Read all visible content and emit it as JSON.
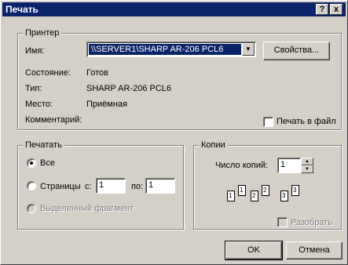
{
  "dialog": {
    "title": "Печать",
    "help_label": "?",
    "close_label": "x"
  },
  "printer": {
    "group_title": "Принтер",
    "name_label": "Имя:",
    "name_value": "\\\\SERVER1\\SHARP AR-206 PCL6",
    "properties_button": "Свойства...",
    "status_label": "Состояние:",
    "status_value": "Готов",
    "type_label": "Тип:",
    "type_value": "SHARP AR-206 PCL6",
    "location_label": "Место:",
    "location_value": "Приёмная",
    "comment_label": "Комментарий:",
    "print_to_file_label": "Печать в файл"
  },
  "print_range": {
    "group_title": "Печатать",
    "all_label": "Все",
    "pages_label": "Страницы",
    "from_label": "с:",
    "from_value": "1",
    "to_label": "по:",
    "to_value": "1",
    "selection_label": "Выделенный фрагмент"
  },
  "copies": {
    "group_title": "Копии",
    "count_label": "Число копий:",
    "count_value": "1",
    "collate_label": "Разобрать",
    "illustration_numbers": [
      "1",
      "1",
      "2",
      "2",
      "3",
      "3"
    ]
  },
  "buttons": {
    "ok": "OK",
    "cancel": "Отмена"
  }
}
